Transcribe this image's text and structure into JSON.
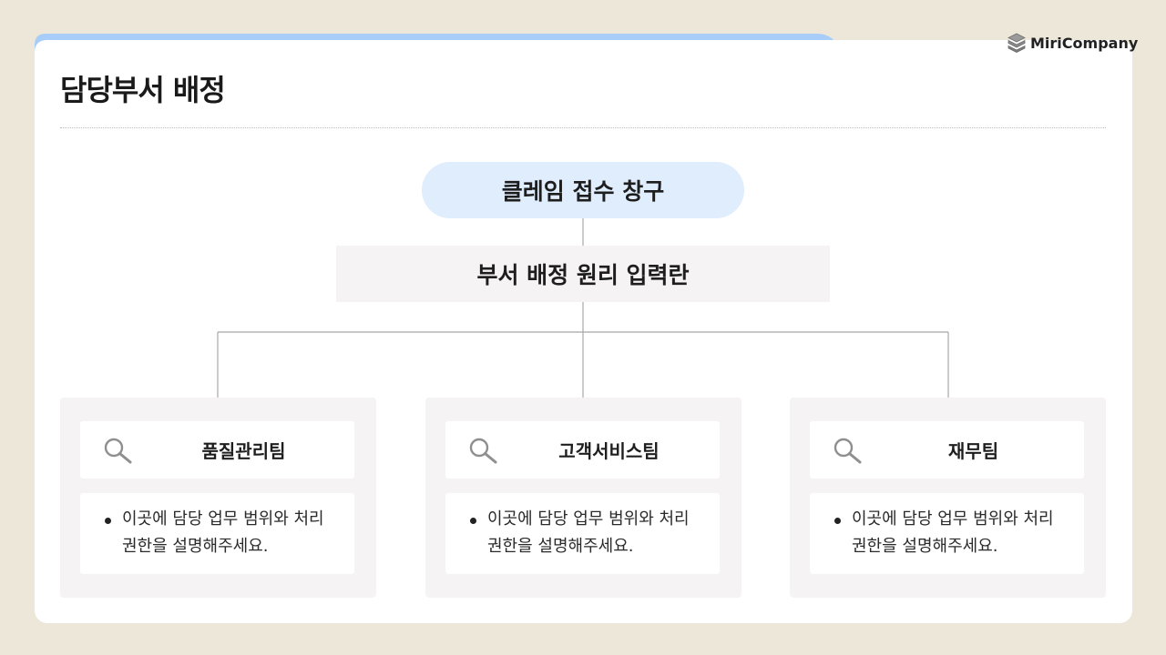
{
  "brand": {
    "name": "MiriCompany",
    "logo_icon": "layers-icon"
  },
  "page": {
    "title": "담당부서 배정"
  },
  "diagram": {
    "root": {
      "label": "클레임 접수 창구"
    },
    "principle": {
      "label": "부서 배정 원리 입력란"
    },
    "departments": [
      {
        "name": "품질관리팀",
        "icon": "search-icon",
        "description": "이곳에 담당 업무 범위와 처리 권한을 설명해주세요."
      },
      {
        "name": "고객서비스팀",
        "icon": "search-icon",
        "description": "이곳에 담당 업무 범위와 처리 권한을 설명해주세요."
      },
      {
        "name": "재무팀",
        "icon": "search-icon",
        "description": "이곳에 담당 업무 범위와 처리 권한을 설명해주세요."
      }
    ]
  },
  "colors": {
    "background": "#ede7d9",
    "tab_accent": "#a9cdf9",
    "root_fill": "#dfedfd",
    "panel_fill": "#f5f3f3"
  }
}
